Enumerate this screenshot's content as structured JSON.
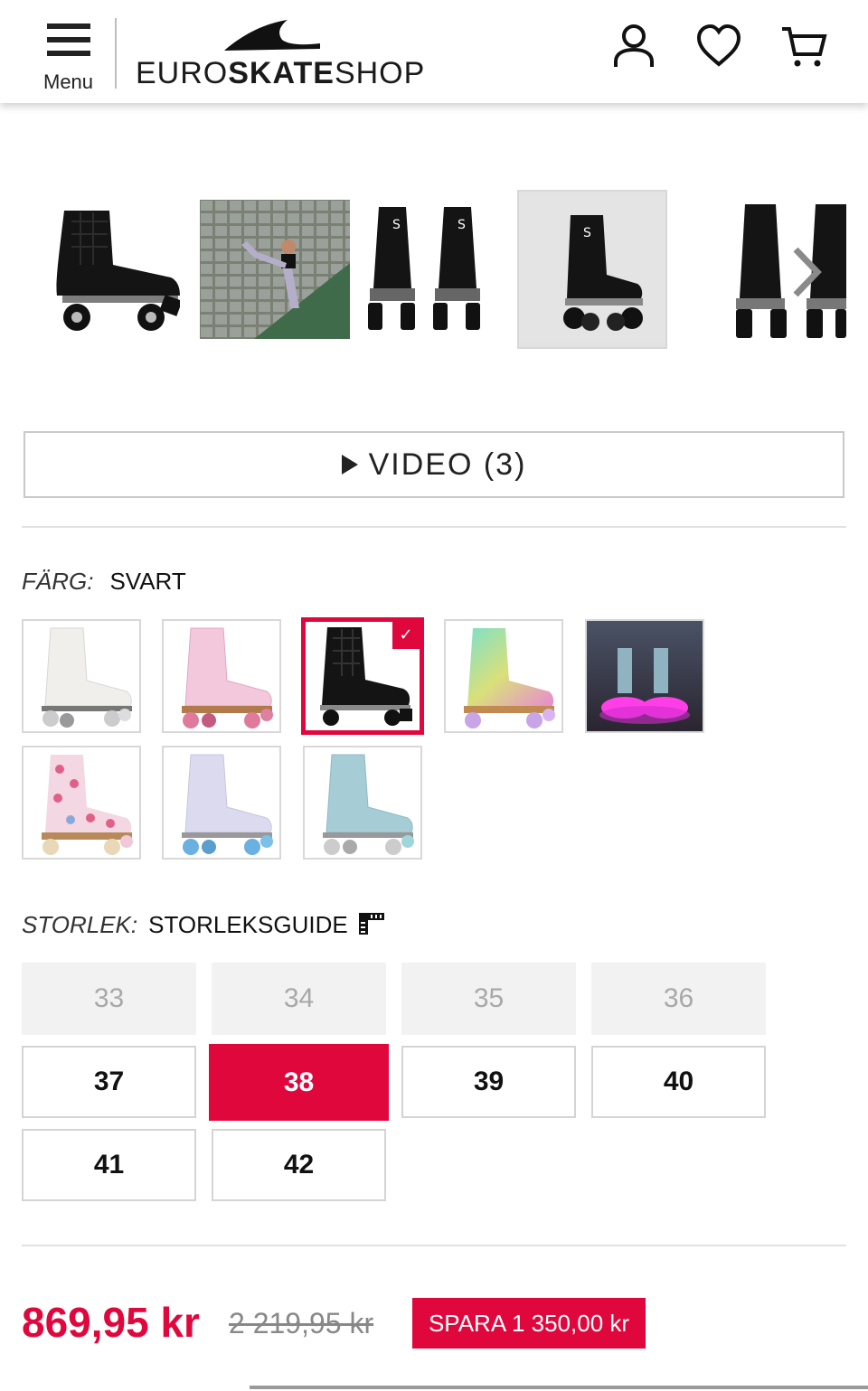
{
  "header": {
    "menu_label": "Menu",
    "logo": {
      "prefix": "EURO",
      "bold": "SKATE",
      "suffix": "SHOP"
    },
    "icons": [
      "account-icon",
      "heart-icon",
      "cart-icon"
    ]
  },
  "gallery": {
    "thumbnails": [
      "Svart quad skate side view",
      "Skater in pose",
      "Pair front view",
      "Skate on grey background",
      "Skates pair angled"
    ],
    "next_icon": "chevron-right-icon"
  },
  "video_button": {
    "label": "VIDEO (3)"
  },
  "color": {
    "label": "FÄRG:",
    "selected_value": "SVART",
    "accent": "#e0073d",
    "swatches": [
      "white",
      "pink",
      "black",
      "holographic",
      "led-pink",
      "floral",
      "lilac",
      "light-blue"
    ],
    "selected_index": 2
  },
  "size": {
    "label": "STORLEK:",
    "guide_label": "STORLEKSGUIDE",
    "options": [
      {
        "value": "33",
        "available": false
      },
      {
        "value": "34",
        "available": false
      },
      {
        "value": "35",
        "available": false
      },
      {
        "value": "36",
        "available": false
      },
      {
        "value": "37",
        "available": true
      },
      {
        "value": "38",
        "available": true,
        "selected": true
      },
      {
        "value": "39",
        "available": true
      },
      {
        "value": "40",
        "available": true
      },
      {
        "value": "41",
        "available": true
      },
      {
        "value": "42",
        "available": true
      }
    ]
  },
  "price": {
    "current": "869,95 kr",
    "original": "2 219,95 kr",
    "savings": "SPARA 1 350,00 kr"
  }
}
